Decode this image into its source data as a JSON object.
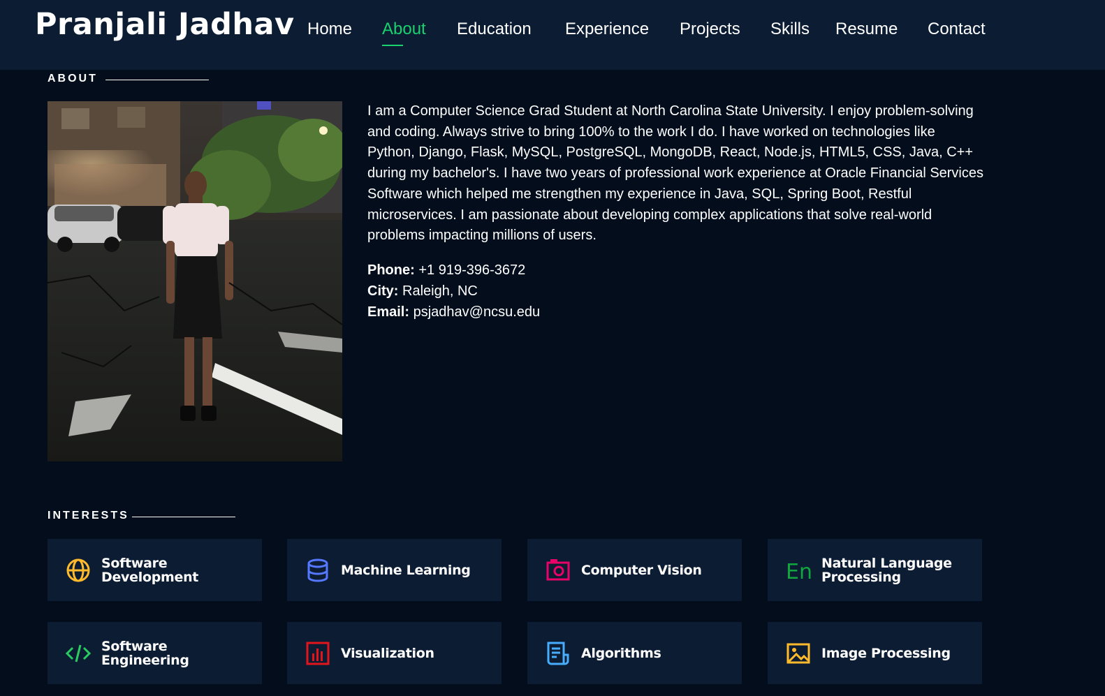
{
  "header": {
    "brand": "Pranjali Jadhav",
    "nav": [
      {
        "label": "Home",
        "active": false
      },
      {
        "label": "About",
        "active": true
      },
      {
        "label": "Education",
        "active": false
      },
      {
        "label": "Experience",
        "active": false
      },
      {
        "label": "Projects",
        "active": false
      },
      {
        "label": "Skills",
        "active": false
      },
      {
        "label": "Resume",
        "active": false
      },
      {
        "label": "Contact",
        "active": false
      }
    ],
    "accent_color": "#18d26e"
  },
  "about": {
    "heading": "ABOUT",
    "bio": "I am a Computer Science Grad Student at North Carolina State University. I enjoy problem-solving and coding. Always strive to bring 100% to the work I do. I have worked on technologies like Python, Django, Flask, MySQL, PostgreSQL, MongoDB, React, Node.js, HTML5, CSS, Java, C++ during my bachelor's. I have two years of professional work experience at Oracle Financial Services Software which helped me strengthen my experience in Java, SQL, Spring Boot, Restful microservices. I am passionate about developing complex applications that solve real-world problems impacting millions of users.",
    "phone_label": "Phone:",
    "phone": "+1 919-396-3672",
    "city_label": "City:",
    "city": "Raleigh, NC",
    "email_label": "Email:",
    "email": "psjadhav@ncsu.edu"
  },
  "interests": {
    "heading": "INTERESTS",
    "items": [
      {
        "label": "Software Development",
        "icon": "globe-icon",
        "color": "#ffbb2c"
      },
      {
        "label": "Machine Learning",
        "icon": "database-icon",
        "color": "#5578ff"
      },
      {
        "label": "Computer Vision",
        "icon": "camera-icon",
        "color": "#e80368"
      },
      {
        "label": "Natural Language Processing",
        "icon": "language-en-icon",
        "color": "#11a63e"
      },
      {
        "label": "Software Engineering",
        "icon": "code-icon",
        "color": "#29cc61"
      },
      {
        "label": "Visualization",
        "icon": "bar-chart-icon",
        "color": "#e2141c"
      },
      {
        "label": "Algorithms",
        "icon": "document-list-icon",
        "color": "#47aeff"
      },
      {
        "label": "Image Processing",
        "icon": "image-icon",
        "color": "#ffa76e"
      }
    ]
  }
}
